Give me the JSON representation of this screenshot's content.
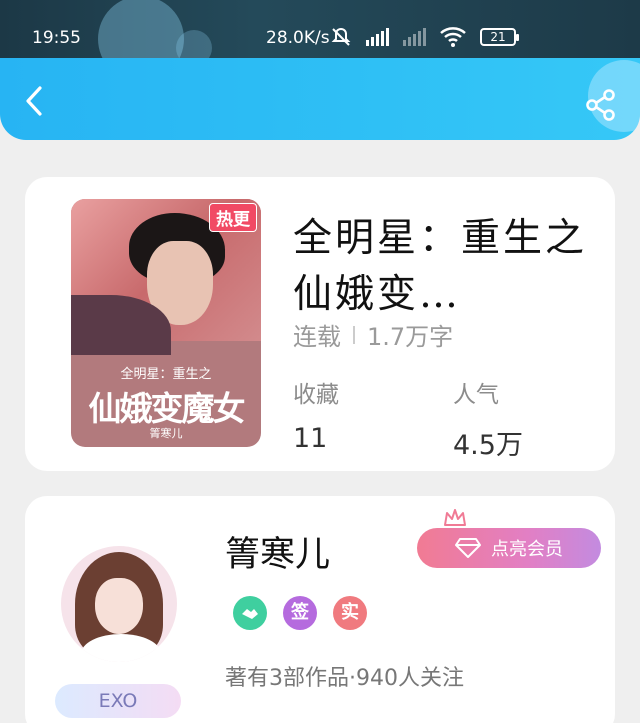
{
  "status_bar": {
    "time": "19:55",
    "net_speed": "28.0K/s",
    "battery": "21"
  },
  "app_bar": {
    "back_icon": "chevron-left-icon",
    "share_icon": "share-icon"
  },
  "book": {
    "cover": {
      "badge": "热更",
      "subtitle": "全明星：重生之",
      "big_title": "仙娥变魔女",
      "author": "箐寒儿"
    },
    "title": "全明星：重生之仙娥变…",
    "status": "连载",
    "word_count": "1.7万字",
    "collect_label": "收藏",
    "collect_value": "11",
    "popularity_label": "人气",
    "popularity_value": "4.5万"
  },
  "author": {
    "name": "箐寒儿",
    "vip_button": "点亮会员",
    "fan_badge": "EXO",
    "tags": [
      {
        "label": "",
        "icon": "handshake-icon",
        "color": "#3fcf9f"
      },
      {
        "label": "签",
        "color": "#b56bde"
      },
      {
        "label": "实",
        "color": "#f07a7f"
      }
    ],
    "stats": "著有3部作品·940人关注"
  }
}
